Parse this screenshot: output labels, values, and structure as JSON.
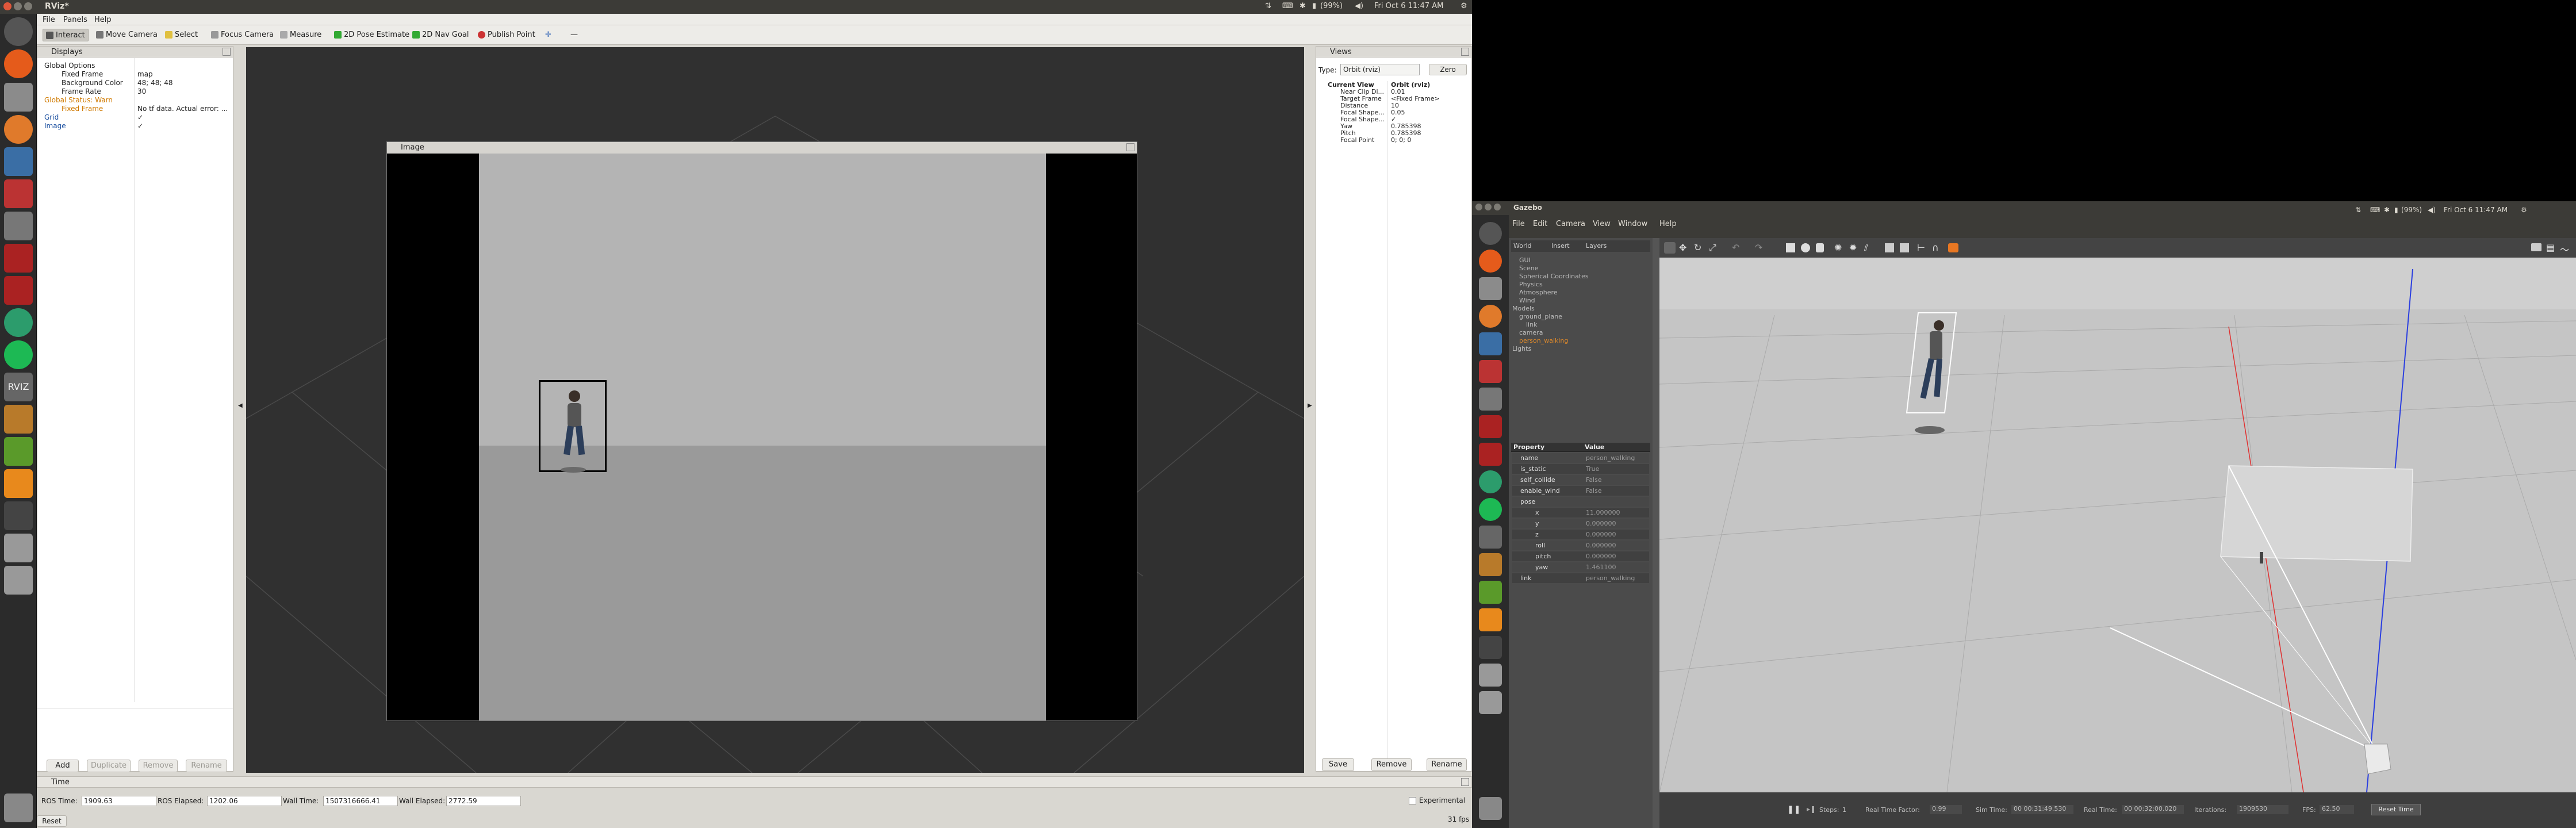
{
  "rviz": {
    "title": "RViz*",
    "tray": {
      "battery": "(99%)",
      "clock": "Fri Oct 6 11:47 AM"
    },
    "menus": [
      "File",
      "Panels",
      "Help"
    ],
    "tools": [
      {
        "label": "Interact",
        "icon": "interact-icon"
      },
      {
        "label": "Move Camera",
        "icon": "move-camera-icon"
      },
      {
        "label": "Select",
        "icon": "select-icon"
      },
      {
        "label": "Focus Camera",
        "icon": "focus-camera-icon"
      },
      {
        "label": "Measure",
        "icon": "measure-icon"
      },
      {
        "label": "2D Pose Estimate",
        "icon": "pose-estimate-icon"
      },
      {
        "label": "2D Nav Goal",
        "icon": "nav-goal-icon"
      },
      {
        "label": "Publish Point",
        "icon": "publish-point-icon"
      }
    ],
    "displays": {
      "title": "Displays",
      "rows": [
        {
          "label": "Global Options",
          "value": "",
          "indent": 1,
          "color": "#222"
        },
        {
          "label": "Fixed Frame",
          "value": "map",
          "indent": 2,
          "color": "#222"
        },
        {
          "label": "Background Color",
          "value": "48; 48; 48",
          "indent": 2,
          "color": "#222"
        },
        {
          "label": "Frame Rate",
          "value": "30",
          "indent": 2,
          "color": "#222"
        },
        {
          "label": "Global Status: Warn",
          "value": "",
          "indent": 1,
          "color": "#d07a00"
        },
        {
          "label": "Fixed Frame",
          "value": "No tf data.  Actual error: ...",
          "indent": 2,
          "color": "#d07a00"
        },
        {
          "label": "Grid",
          "value": "✓",
          "indent": 1,
          "color": "#1a4fa0"
        },
        {
          "label": "Image",
          "value": "✓",
          "indent": 1,
          "color": "#1a4fa0"
        }
      ],
      "buttons": [
        "Add",
        "Duplicate",
        "Remove",
        "Rename"
      ]
    },
    "image_panel": {
      "title": "Image"
    },
    "views": {
      "title": "Views",
      "type_label": "Type:",
      "type_value": "Orbit (rviz)",
      "zero": "Zero",
      "rows": [
        {
          "label": "Current View",
          "value": "Orbit (rviz)",
          "bold": true
        },
        {
          "label": "Near Clip Di...",
          "value": "0.01"
        },
        {
          "label": "Target Frame",
          "value": "<Fixed Frame>"
        },
        {
          "label": "Distance",
          "value": "10"
        },
        {
          "label": "Focal Shape...",
          "value": "0.05"
        },
        {
          "label": "Focal Shape...",
          "value": "✓"
        },
        {
          "label": "Yaw",
          "value": "0.785398"
        },
        {
          "label": "Pitch",
          "value": "0.785398"
        },
        {
          "label": "Focal Point",
          "value": "0; 0; 0"
        }
      ],
      "buttons": [
        "Save",
        "Remove",
        "Rename"
      ]
    },
    "time": {
      "title": "Time",
      "ros_time_label": "ROS Time:",
      "ros_time": "1909.63",
      "ros_elapsed_label": "ROS Elapsed:",
      "ros_elapsed": "1202.06",
      "wall_time_label": "Wall Time:",
      "wall_time": "1507316666.41",
      "wall_elapsed_label": "Wall Elapsed:",
      "wall_elapsed": "2772.59",
      "experimental": "Experimental",
      "reset": "Reset",
      "fps": "31 fps"
    }
  },
  "gazebo": {
    "title": "Gazebo",
    "tray": {
      "battery": "(99%)",
      "clock": "Fri Oct 6 11:47 AM"
    },
    "menus": [
      "File",
      "Edit",
      "Camera",
      "View",
      "Window",
      "Help"
    ],
    "tabs": [
      "World",
      "Insert",
      "Layers"
    ],
    "tree": [
      "GUI",
      "Scene",
      "Spherical Coordinates",
      "Physics",
      "Atmosphere",
      "Wind",
      "Models",
      "ground_plane",
      "link",
      "camera",
      "person_walking",
      "Lights"
    ],
    "prop_header": {
      "property": "Property",
      "value": "Value"
    },
    "props": [
      {
        "k": "name",
        "v": "person_walking"
      },
      {
        "k": "is_static",
        "v": "True"
      },
      {
        "k": "self_collide",
        "v": "False"
      },
      {
        "k": "enable_wind",
        "v": "False"
      },
      {
        "k": "pose",
        "v": ""
      },
      {
        "k": "x",
        "v": "11.000000"
      },
      {
        "k": "y",
        "v": "0.000000"
      },
      {
        "k": "z",
        "v": "0.000000"
      },
      {
        "k": "roll",
        "v": "0.000000"
      },
      {
        "k": "pitch",
        "v": "0.000000"
      },
      {
        "k": "yaw",
        "v": "1.461100"
      },
      {
        "k": "link",
        "v": "person_walking"
      }
    ],
    "bottom": {
      "steps_label": "Steps:",
      "steps": "1",
      "rtf_label": "Real Time Factor:",
      "rtf": "0.99",
      "sim_label": "Sim Time:",
      "sim": "00 00:31:49.530",
      "real_label": "Real Time:",
      "real": "00 00:32:00.020",
      "iter_label": "Iterations:",
      "iter": "1909530",
      "fps_label": "FPS:",
      "fps": "62.50",
      "reset": "Reset Time"
    }
  }
}
